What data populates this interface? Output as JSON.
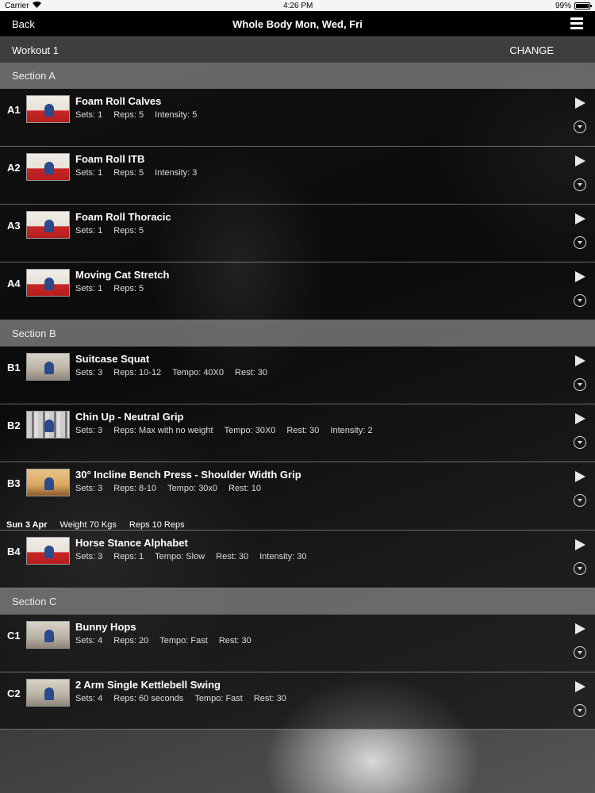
{
  "status_bar": {
    "carrier": "Carrier",
    "time": "4:26 PM",
    "battery": "99%"
  },
  "nav": {
    "back_label": "Back",
    "title": "Whole Body Mon, Wed, Fri"
  },
  "workout": {
    "label": "Workout 1",
    "change_label": "CHANGE"
  },
  "sections": [
    {
      "title": "Section A"
    },
    {
      "title": "Section B"
    },
    {
      "title": "Section C"
    }
  ],
  "exercises": [
    {
      "code": "A1",
      "name": "Foam Roll Calves",
      "meta": [
        "Sets: 1",
        "Reps: 5",
        "Intensity: 5"
      ],
      "thumb": "red"
    },
    {
      "code": "A2",
      "name": "Foam Roll ITB",
      "meta": [
        "Sets: 1",
        "Reps: 5",
        "Intensity: 3"
      ],
      "thumb": "red"
    },
    {
      "code": "A3",
      "name": "Foam Roll Thoracic",
      "meta": [
        "Sets: 1",
        "Reps: 5"
      ],
      "thumb": "red"
    },
    {
      "code": "A4",
      "name": "Moving Cat Stretch",
      "meta": [
        "Sets: 1",
        "Reps: 5"
      ],
      "thumb": "red"
    },
    {
      "code": "B1",
      "name": "Suitcase Squat",
      "meta": [
        "Sets: 3",
        "Reps: 10-12",
        "Tempo: 40X0",
        "Rest: 30"
      ],
      "thumb": "gym"
    },
    {
      "code": "B2",
      "name": "Chin Up - Neutral Grip",
      "meta": [
        "Sets: 3",
        "Reps: Max with no weight",
        "Tempo: 30X0",
        "Rest: 30",
        "Intensity: 2"
      ],
      "thumb": "rack"
    },
    {
      "code": "B3",
      "name": "30° Incline Bench Press - Shoulder Width Grip",
      "meta": [
        "Sets: 3",
        "Reps: 8-10",
        "Tempo: 30x0",
        "Rest: 10"
      ],
      "thumb": "bench"
    },
    {
      "code": "B4",
      "name": "Horse Stance Alphabet",
      "meta": [
        "Sets: 3",
        "Reps: 1",
        "Tempo: Slow",
        "Rest: 30",
        "Intensity: 30"
      ],
      "thumb": "red"
    },
    {
      "code": "C1",
      "name": "Bunny Hops",
      "meta": [
        "Sets: 4",
        "Reps: 20",
        "Tempo: Fast",
        "Rest: 30"
      ],
      "thumb": "gym"
    },
    {
      "code": "C2",
      "name": "2 Arm Single Kettlebell Swing",
      "meta": [
        "Sets: 4",
        "Reps: 60 seconds",
        "Tempo: Fast",
        "Rest: 30"
      ],
      "thumb": "gym"
    }
  ],
  "history": {
    "date": "Sun 3 Apr",
    "weight": "Weight 70 Kgs",
    "reps": "Reps 10 Reps"
  },
  "icons": {
    "wifi": "wifi-icon",
    "battery": "battery-icon",
    "menu": "hamburger-menu-icon",
    "play": "play-icon",
    "expand": "chevron-down-circle-icon"
  }
}
